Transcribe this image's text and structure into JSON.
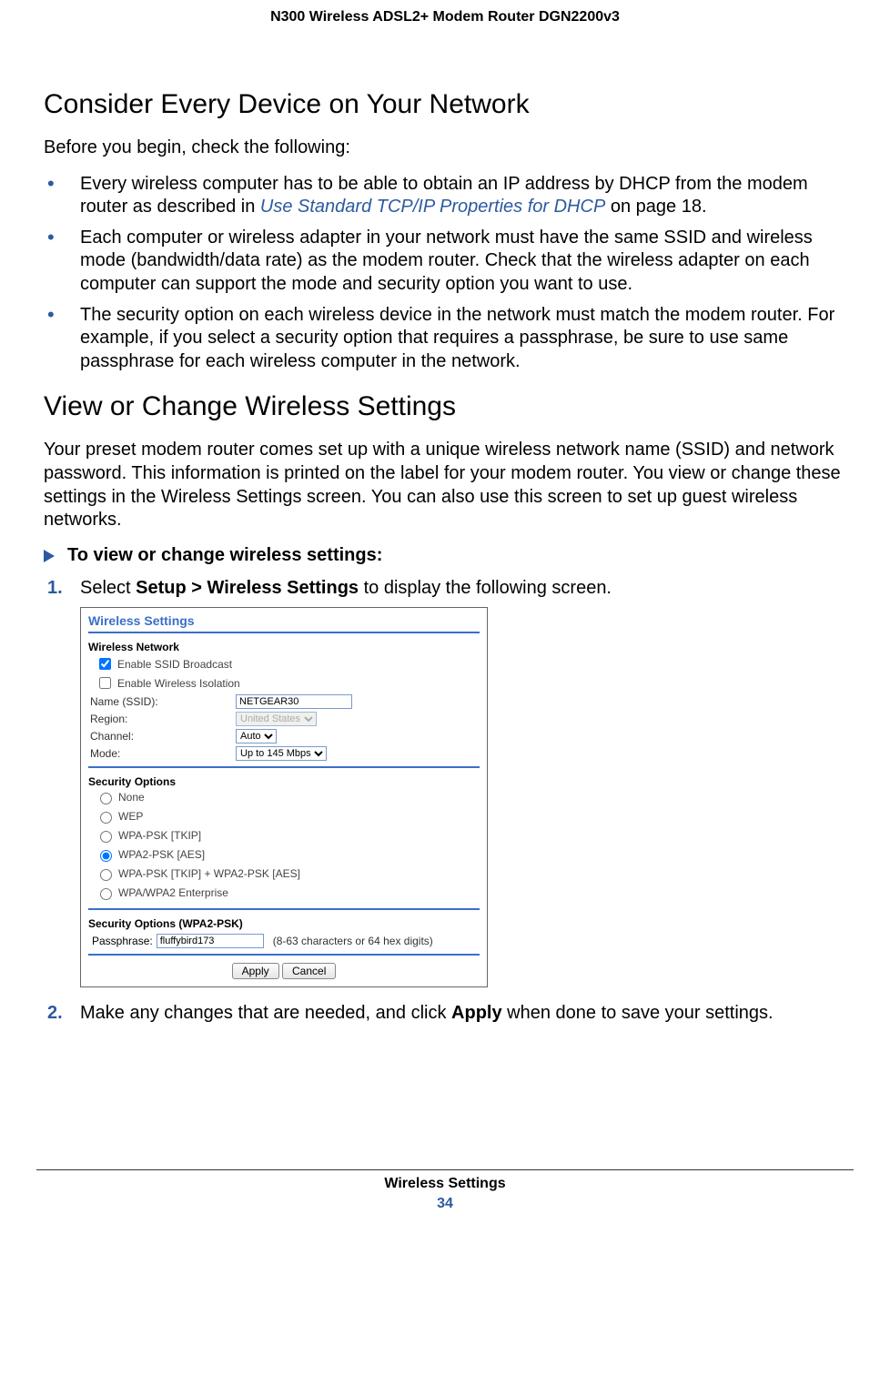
{
  "running_header": "N300 Wireless ADSL2+ Modem Router DGN2200v3",
  "sec1": {
    "title": "Consider Every Device on Your Network",
    "intro": "Before you begin, check the following:",
    "b1a": "Every wireless computer has to be able to obtain an IP address by DHCP from the modem router as described in ",
    "b1_link": "Use Standard TCP/IP Properties for DHCP",
    "b1b": " on page 18.",
    "b2": "Each computer or wireless adapter in your network must have the same SSID and wireless mode (bandwidth/data rate) as the modem router. Check that the wireless adapter on each computer can support the mode and security option you want to use.",
    "b3": "The security option on each wireless device in the network must match the modem router. For example, if you select a security option that requires a passphrase, be sure to use same passphrase for each wireless computer in the network."
  },
  "sec2": {
    "title": "View or Change Wireless Settings",
    "intro": "Your preset modem router comes set up with a unique wireless network name (SSID) and network password. This information is printed on the label for your modem router. You view or change these settings in the Wireless Settings screen. You can also use this screen to set up guest wireless networks.",
    "proc": "To view or change wireless settings:",
    "step1a": "Select ",
    "step1b": "Setup > Wireless Settings",
    "step1c": " to display the following screen.",
    "step2a": "Make any changes that are needed, and click ",
    "step2b": "Apply",
    "step2c": " when done to save your settings."
  },
  "panel": {
    "title": "Wireless Settings",
    "grp_network": "Wireless Network",
    "enable_ssid": "Enable SSID Broadcast",
    "enable_iso": "Enable Wireless Isolation",
    "name_label": "Name (SSID):",
    "name_value": "NETGEAR30",
    "region_label": "Region:",
    "region_value": "United States",
    "channel_label": "Channel:",
    "channel_value": "Auto",
    "mode_label": "Mode:",
    "mode_value": "Up to 145 Mbps",
    "grp_sec": "Security Options",
    "r_none": "None",
    "r_wep": "WEP",
    "r_tkip": "WPA-PSK [TKIP]",
    "r_aes": "WPA2-PSK [AES]",
    "r_both": "WPA-PSK [TKIP] + WPA2-PSK [AES]",
    "r_ent": "WPA/WPA2 Enterprise",
    "grp_pass": "Security Options (WPA2-PSK)",
    "pass_label": "Passphrase:",
    "pass_value": "fluffybird173",
    "pass_hint": "(8-63 characters or 64 hex digits)",
    "apply": "Apply",
    "cancel": "Cancel"
  },
  "footer": {
    "title": "Wireless Settings",
    "page": "34"
  }
}
